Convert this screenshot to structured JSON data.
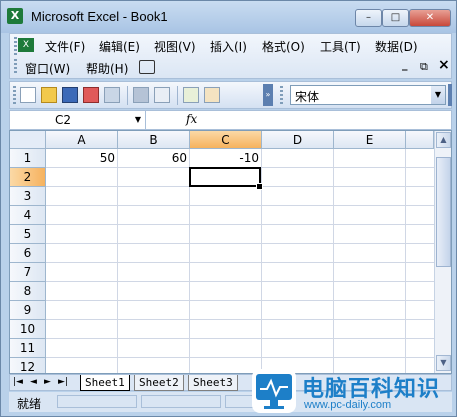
{
  "window": {
    "title": "Microsoft Excel - Book1",
    "app_icon_glyph": "X",
    "buttons": {
      "minimize": "–",
      "maximize": "□",
      "close": "✕"
    }
  },
  "menubar": {
    "items": [
      {
        "label": "文件(F)"
      },
      {
        "label": "编辑(E)"
      },
      {
        "label": "视图(V)"
      },
      {
        "label": "插入(I)"
      },
      {
        "label": "格式(O)"
      },
      {
        "label": "工具(T)"
      },
      {
        "label": "数据(D)"
      },
      {
        "label": "窗口(W)"
      },
      {
        "label": "帮助(H)"
      }
    ],
    "mdi_controls": {
      "minimize": "_",
      "restore": "⧉",
      "close": "×"
    }
  },
  "toolbar": {
    "font_name": "宋体",
    "icons": [
      "new-icon",
      "open-icon",
      "save-icon",
      "permission-icon",
      "email-icon",
      "print-icon",
      "print-preview-icon",
      "spelling-icon",
      "research-icon"
    ]
  },
  "formula_bar": {
    "name_box": "C2",
    "fx_label": "fx",
    "content": ""
  },
  "grid": {
    "columns": [
      "A",
      "B",
      "C",
      "D",
      "E"
    ],
    "rows": [
      "1",
      "2",
      "3",
      "4",
      "5",
      "6",
      "7",
      "8",
      "9",
      "10",
      "11",
      "12"
    ],
    "selected_column": "C",
    "selected_row": "2",
    "cells": [
      {
        "ref": "A1",
        "value": "50"
      },
      {
        "ref": "B1",
        "value": "60"
      },
      {
        "ref": "C1",
        "value": "-10"
      }
    ]
  },
  "sheet_tabs": {
    "nav": [
      "|◄",
      "◄",
      "►",
      "►|"
    ],
    "tabs": [
      "Sheet1",
      "Sheet2",
      "Sheet3"
    ]
  },
  "status_bar": {
    "text": "就绪"
  },
  "watermark": {
    "main": "电脑百科知识",
    "sub": "www.pc-daily.com"
  },
  "colors": {
    "accent": "#1d7fc8",
    "selected_header": "#f6b25e",
    "window_frame": "#b9d1ea"
  }
}
